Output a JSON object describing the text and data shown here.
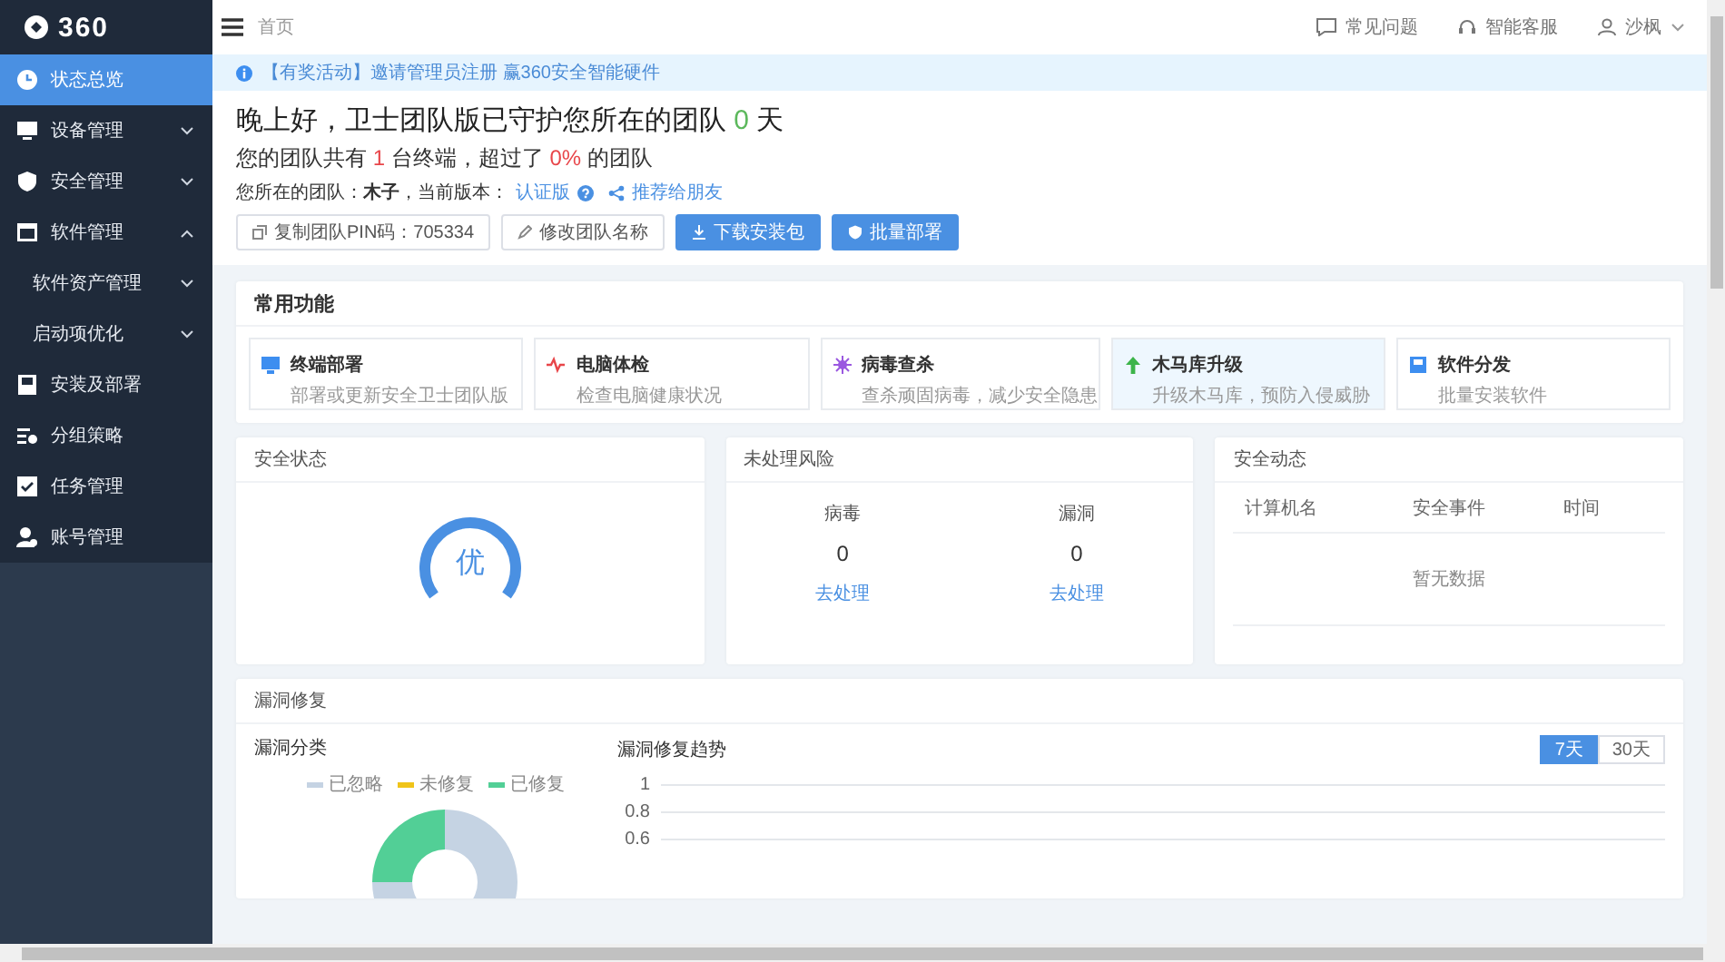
{
  "sidebar": {
    "logo": "360",
    "items": [
      {
        "label": "状态总览",
        "selected": true
      },
      {
        "label": "设备管理",
        "selected": false,
        "expanded": false
      },
      {
        "label": "安全管理",
        "selected": false,
        "expanded": false
      },
      {
        "label": "软件管理",
        "selected": false,
        "expanded": true,
        "children": [
          {
            "label": "软件资产管理",
            "selected": false,
            "expanded": false
          },
          {
            "label": "启动项优化",
            "selected": false,
            "expanded": false
          }
        ]
      },
      {
        "label": "安装及部署",
        "selected": false
      },
      {
        "label": "分组策略",
        "selected": false
      },
      {
        "label": "任务管理",
        "selected": false
      },
      {
        "label": "账号管理",
        "selected": false
      }
    ]
  },
  "topbar": {
    "breadcrumb": "首页",
    "links": [
      "常见问题",
      "智能客服"
    ],
    "user": "沙枫"
  },
  "notice": "【有奖活动】邀请管理员注册 赢360安全智能硬件",
  "welcome": {
    "greeting": [
      "晚上好，卫士团队版已守护您所在的团队",
      "0",
      "天"
    ],
    "summary": [
      "您的团队共有",
      "1",
      "台终端，超过了",
      "0%",
      "的团队"
    ],
    "team_label": "您所在的团队：",
    "team_name": "木子",
    "version_label": "，当前版本：",
    "version": "认证版",
    "recommend": "推荐给朋友",
    "buttons": [
      {
        "label": "复制团队PIN码：705334",
        "kind": "default"
      },
      {
        "label": "修改团队名称",
        "kind": "default"
      },
      {
        "label": "下载安装包",
        "kind": "primary"
      },
      {
        "label": "批量部署",
        "kind": "primary"
      }
    ]
  },
  "functions": {
    "title": "常用功能",
    "items": [
      {
        "title": "终端部署",
        "desc": "部署或更新安全卫士团队版",
        "selected": false
      },
      {
        "title": "电脑体检",
        "desc": "检查电脑健康状况",
        "selected": false
      },
      {
        "title": "病毒查杀",
        "desc": "查杀顽固病毒，减少安全隐患",
        "selected": false
      },
      {
        "title": "木马库升级",
        "desc": "升级木马库，预防入侵威胁",
        "selected": true
      },
      {
        "title": "软件分发",
        "desc": "批量安装软件",
        "selected": false
      }
    ]
  },
  "security_status": {
    "title": "安全状态",
    "grade": "优"
  },
  "risks": {
    "title": "未处理风险",
    "items": [
      {
        "label": "病毒",
        "count": "0",
        "action": "去处理"
      },
      {
        "label": "漏洞",
        "count": "0",
        "action": "去处理"
      }
    ]
  },
  "activity": {
    "title": "安全动态",
    "columns": [
      "计算机名",
      "安全事件",
      "时间"
    ],
    "empty": "暂无数据"
  },
  "vuln": {
    "title": "漏洞修复",
    "category_title": "漏洞分类",
    "legend": [
      {
        "label": "已忽略",
        "color": "#c5d3e3"
      },
      {
        "label": "未修复",
        "color": "#f0c419"
      },
      {
        "label": "已修复",
        "color": "#52cf96"
      }
    ],
    "trend_title": "漏洞修复趋势",
    "ranges": [
      {
        "label": "7天",
        "selected": true
      },
      {
        "label": "30天",
        "selected": false
      }
    ],
    "y_tick_labels": [
      "1",
      "0.8",
      "0.6"
    ]
  }
}
